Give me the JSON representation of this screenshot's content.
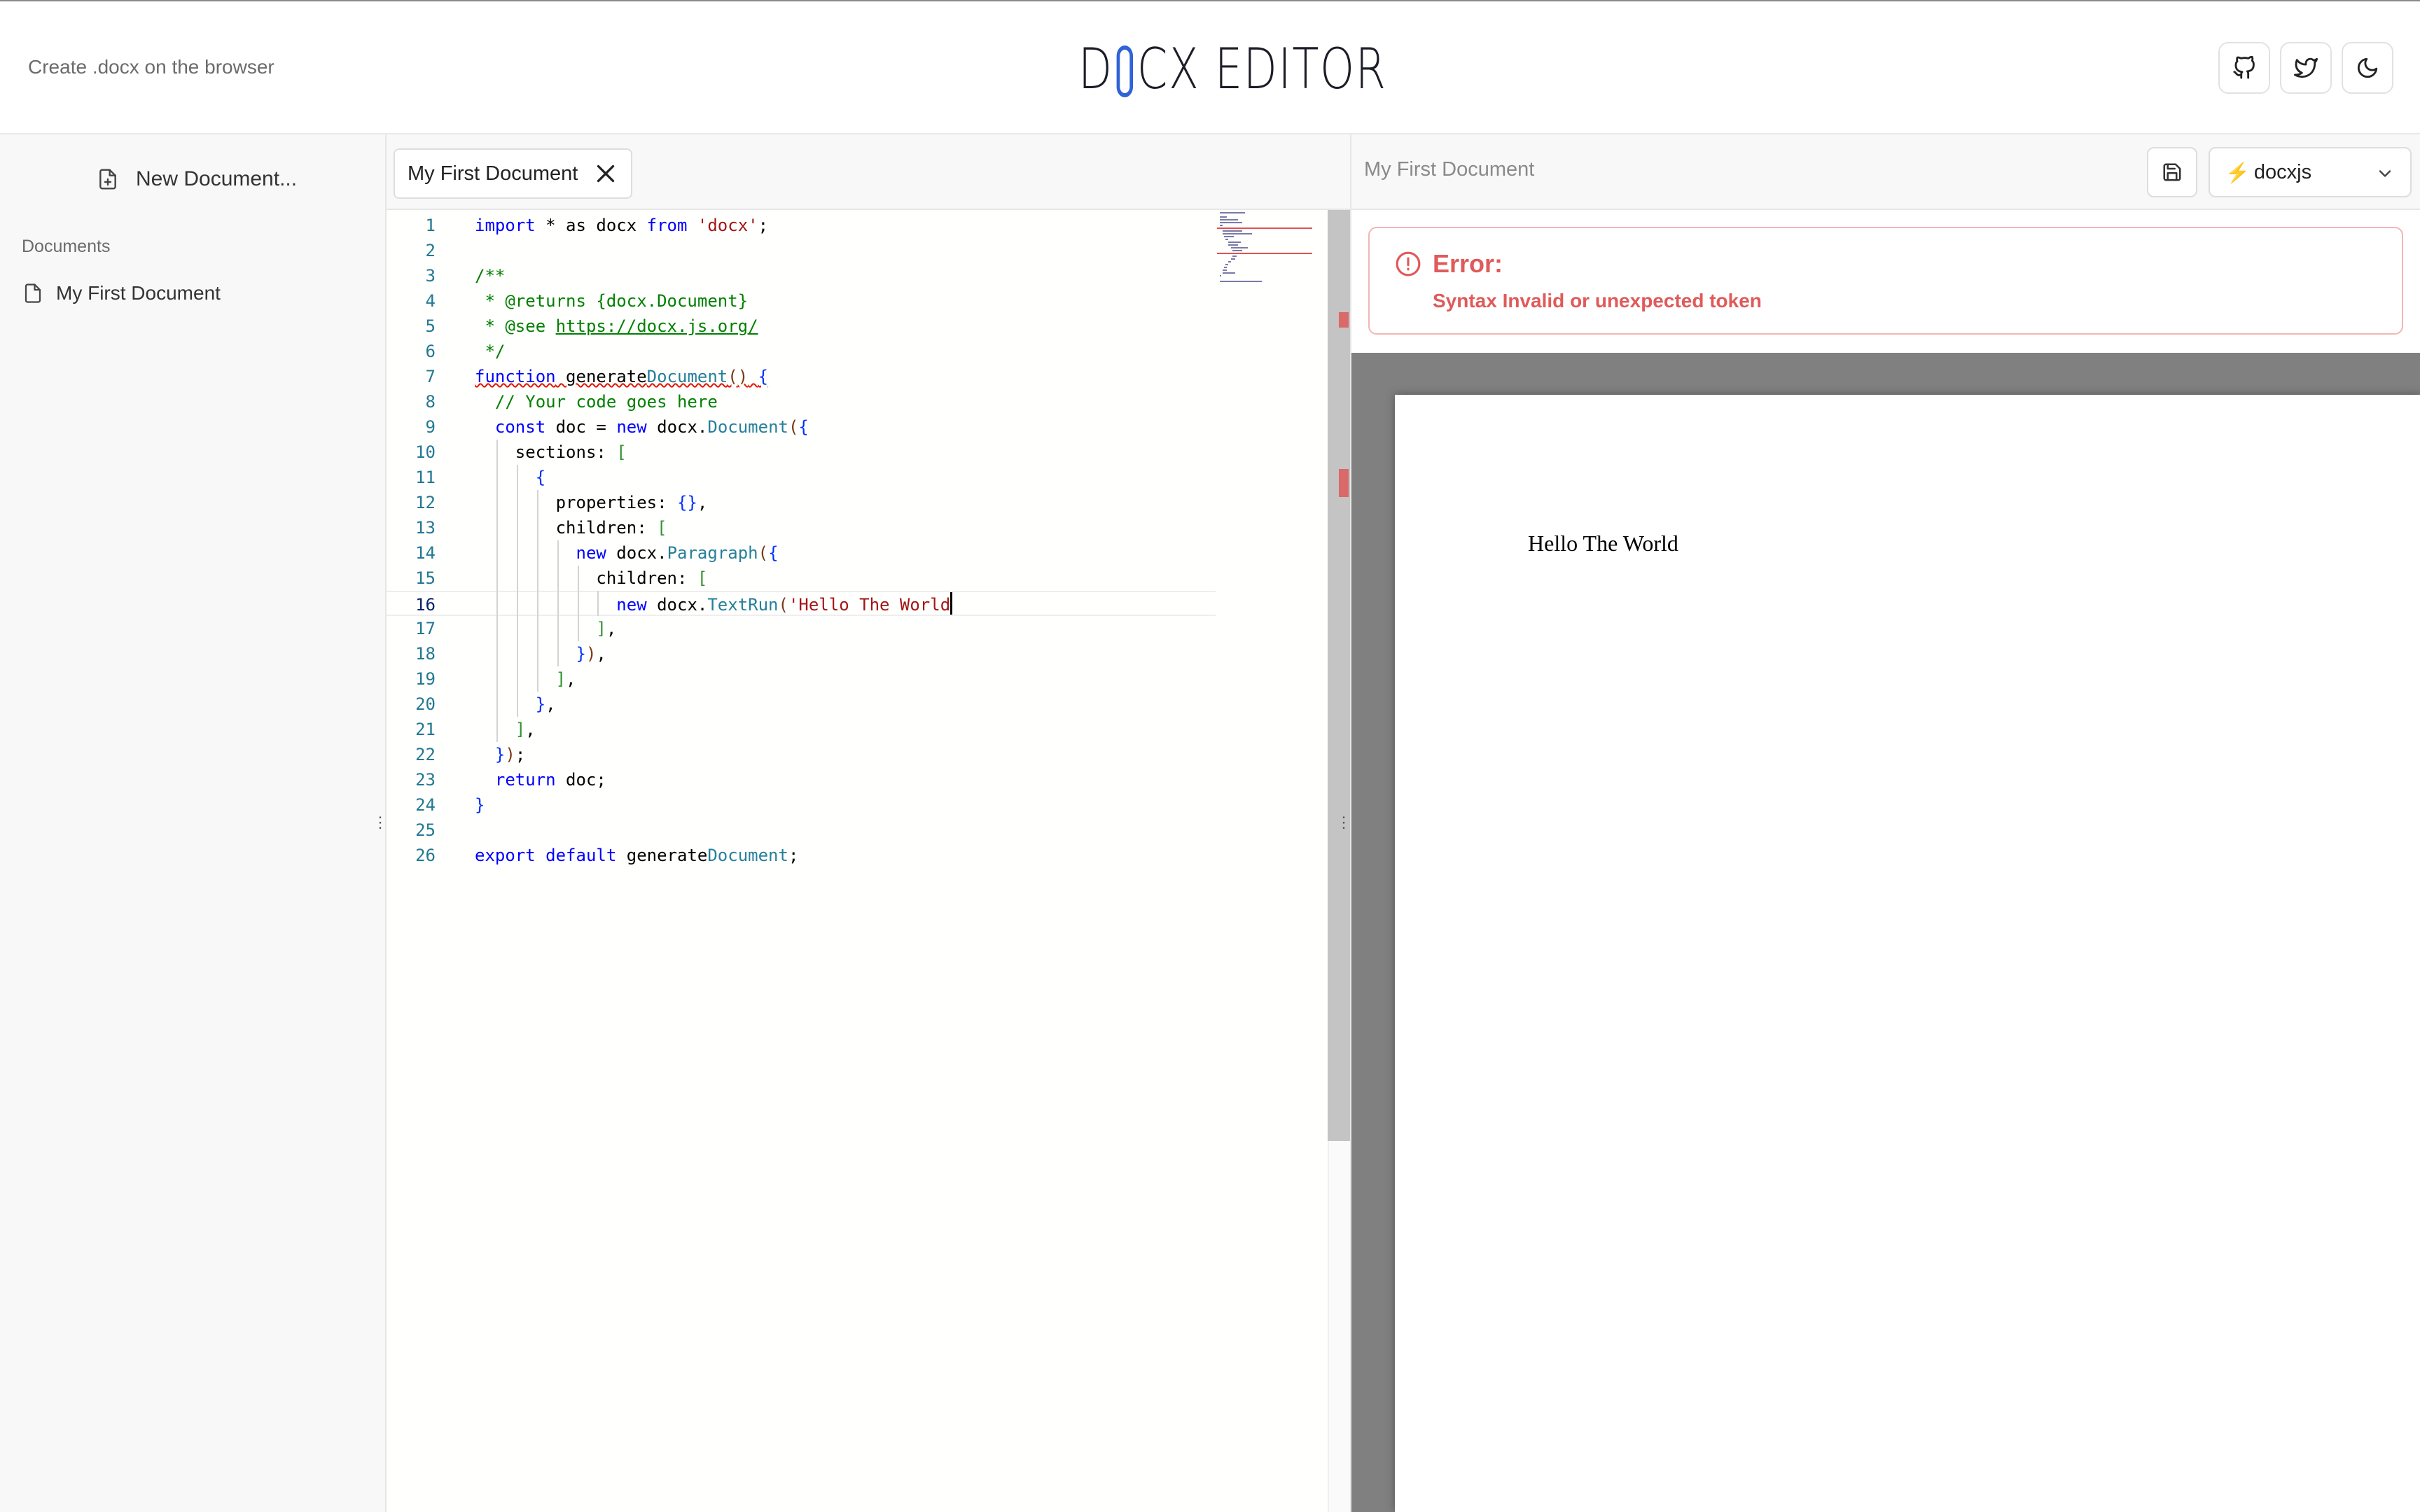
{
  "header": {
    "tagline": "Create .docx on the browser",
    "logo_left": "D",
    "logo_right": "CX EDITOR",
    "buttons": [
      "github-icon",
      "twitter-icon",
      "moon-icon"
    ]
  },
  "sidebar": {
    "new_document_label": "New Document...",
    "documents_heading": "Documents",
    "documents": [
      "My First Document"
    ]
  },
  "editor": {
    "tab_label": "My First Document",
    "current_line": 16,
    "lines": [
      "import * as docx from 'docx';",
      "",
      "/**",
      " * @returns {docx.Document}",
      " * @see https://docx.js.org/",
      " */",
      "function generateDocument() {",
      "  // Your code goes here",
      "  const doc = new docx.Document({",
      "    sections: [",
      "      {",
      "        properties: {},",
      "        children: [",
      "          new docx.Paragraph({",
      "            children: [",
      "              new docx.TextRun('Hello The World",
      "            ],",
      "          }),",
      "        ],",
      "      },",
      "    ],",
      "  });",
      "  return doc;",
      "}",
      "",
      "export default generateDocument;"
    ]
  },
  "preview": {
    "title": "My First Document",
    "engine": "docxjs",
    "engine_icon": "⚡",
    "error_title": "Error:",
    "error_message": "Syntax Invalid or unexpected token",
    "document_text": "Hello The World"
  },
  "colors": {
    "accent_blue": "#2f63d6",
    "error_red": "#e05a5a",
    "keyword": "#0000ff",
    "string": "#a31515",
    "comment": "#008000",
    "type": "#267f99"
  }
}
